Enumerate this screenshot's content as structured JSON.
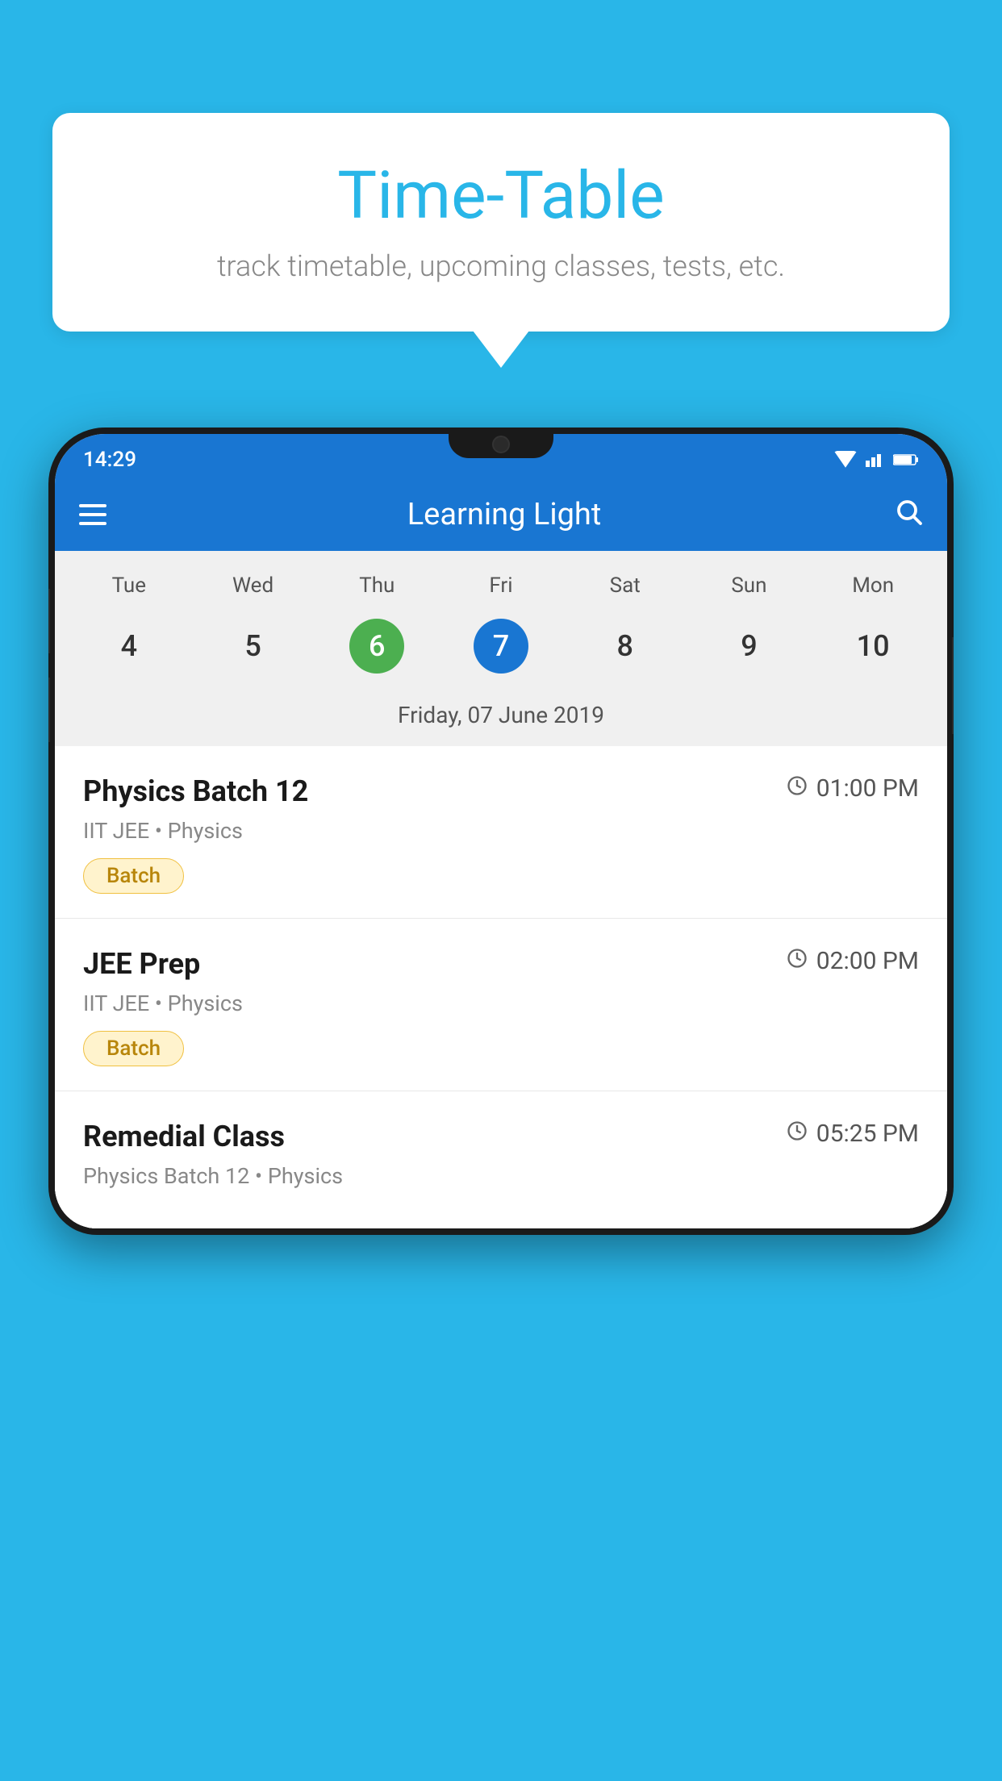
{
  "background_color": "#29b6e8",
  "bubble": {
    "title": "Time-Table",
    "subtitle": "track timetable, upcoming classes, tests, etc."
  },
  "app": {
    "name": "Learning Light",
    "menu_label": "Menu",
    "search_label": "Search"
  },
  "status_bar": {
    "time": "14:29"
  },
  "calendar": {
    "selected_date_label": "Friday, 07 June 2019",
    "days": [
      {
        "name": "Tue",
        "number": "4",
        "state": "normal"
      },
      {
        "name": "Wed",
        "number": "5",
        "state": "normal"
      },
      {
        "name": "Thu",
        "number": "6",
        "state": "today"
      },
      {
        "name": "Fri",
        "number": "7",
        "state": "selected"
      },
      {
        "name": "Sat",
        "number": "8",
        "state": "normal"
      },
      {
        "name": "Sun",
        "number": "9",
        "state": "normal"
      },
      {
        "name": "Mon",
        "number": "10",
        "state": "normal"
      }
    ]
  },
  "classes": [
    {
      "name": "Physics Batch 12",
      "time": "01:00 PM",
      "meta": "IIT JEE • Physics",
      "badge": "Batch"
    },
    {
      "name": "JEE Prep",
      "time": "02:00 PM",
      "meta": "IIT JEE • Physics",
      "badge": "Batch"
    },
    {
      "name": "Remedial Class",
      "time": "05:25 PM",
      "meta": "Physics Batch 12 • Physics",
      "badge": ""
    }
  ]
}
